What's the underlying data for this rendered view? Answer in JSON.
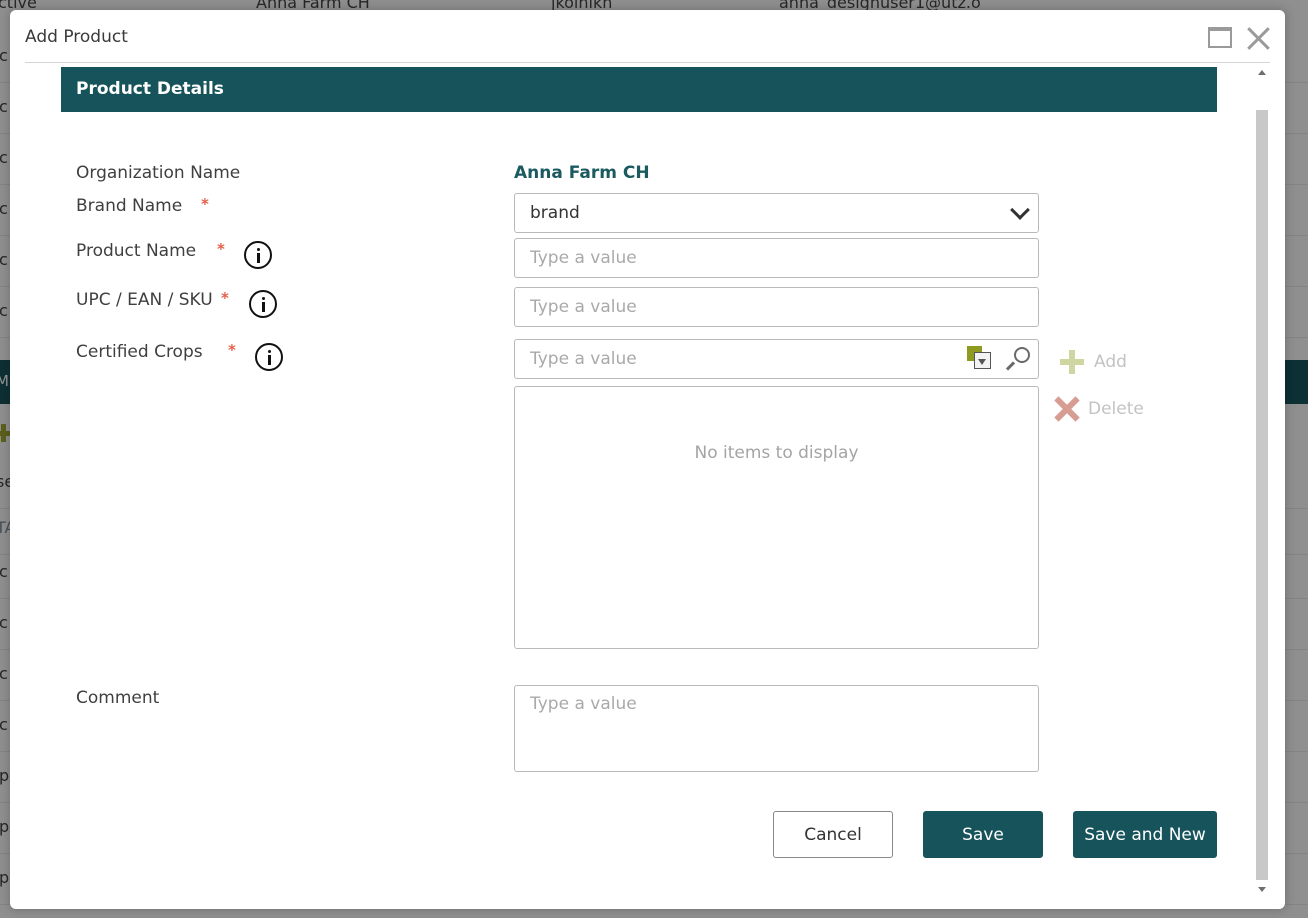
{
  "background": {
    "top_row": [
      "ctive",
      "Anna Farm CH",
      "jkolnikn",
      "anna_designuser1@utz.o"
    ],
    "row_prefixes": [
      "c",
      "c",
      "c",
      "c",
      "c",
      "c"
    ],
    "band_text": "M",
    "lower_row_prefixes": [
      "se",
      "TA",
      "c",
      "c",
      "c",
      "c",
      "p",
      "p",
      "p"
    ]
  },
  "dialog": {
    "title": "Add Product",
    "section_title": "Product Details"
  },
  "fields": {
    "organization": {
      "label": "Organization Name",
      "value": "Anna Farm CH"
    },
    "brand": {
      "label": "Brand Name",
      "required": "*",
      "value": "brand"
    },
    "product_name": {
      "label": "Product Name",
      "required": "*",
      "placeholder": "Type a value"
    },
    "upc": {
      "label": "UPC / EAN / SKU",
      "required": "*",
      "placeholder": "Type a value"
    },
    "crops": {
      "label": "Certified Crops",
      "required": "*",
      "placeholder": "Type a value",
      "empty_text": "No items to display",
      "add_label": "Add",
      "delete_label": "Delete"
    },
    "comment": {
      "label": "Comment",
      "placeholder": "Type a value"
    }
  },
  "buttons": {
    "cancel": "Cancel",
    "save": "Save",
    "save_new": "Save and New"
  },
  "colors": {
    "primary": "#17535a",
    "required": "#e5604a",
    "add_accent": "#d0d6a2",
    "delete_accent": "#d79d93"
  }
}
